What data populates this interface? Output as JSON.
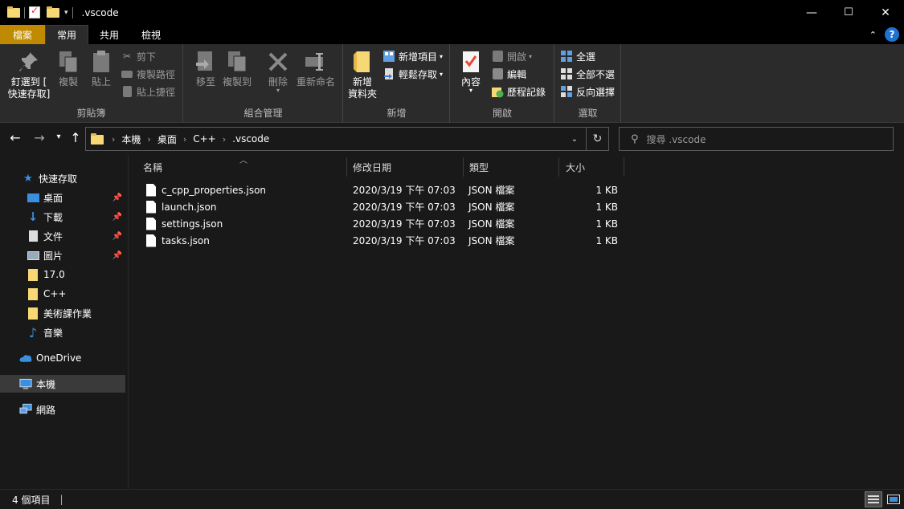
{
  "window": {
    "title": ".vscode",
    "minimize": "—",
    "maximize": "☐",
    "close": "✕"
  },
  "ribbon_tabs": [
    "檔案",
    "常用",
    "共用",
    "檢視"
  ],
  "ribbon": {
    "clipboard": {
      "label": "剪貼簿",
      "pin_label_1": "釘選到 [",
      "pin_label_2": "快速存取]",
      "copy": "複製",
      "paste": "貼上",
      "cut": "剪下",
      "copy_path": "複製路徑",
      "paste_shortcut": "貼上捷徑"
    },
    "organize": {
      "label": "組合管理",
      "move_to": "移至",
      "copy_to": "複製到",
      "delete": "刪除",
      "rename": "重新命名"
    },
    "new": {
      "label": "新增",
      "new_folder_1": "新增",
      "new_folder_2": "資料夾",
      "new_item": "新增項目",
      "easy_access": "輕鬆存取"
    },
    "open": {
      "label": "開啟",
      "properties": "內容",
      "open": "開啟",
      "edit": "編輯",
      "history": "歷程記錄"
    },
    "select": {
      "label": "選取",
      "select_all": "全選",
      "select_none": "全部不選",
      "invert": "反向選擇"
    }
  },
  "address": {
    "crumbs": [
      "本機",
      "桌面",
      "C++",
      ".vscode"
    ],
    "search_placeholder": "搜尋 .vscode"
  },
  "sidebar": {
    "quick_access": "快速存取",
    "items": [
      {
        "label": "桌面",
        "pinned": true
      },
      {
        "label": "下載",
        "pinned": true
      },
      {
        "label": "文件",
        "pinned": true
      },
      {
        "label": "圖片",
        "pinned": true
      },
      {
        "label": "17.0"
      },
      {
        "label": "C++"
      },
      {
        "label": "美術課作業"
      },
      {
        "label": "音樂"
      }
    ],
    "onedrive": "OneDrive",
    "this_pc": "本機",
    "network": "網路"
  },
  "columns": [
    "名稱",
    "修改日期",
    "類型",
    "大小"
  ],
  "files": [
    {
      "name": "c_cpp_properties.json",
      "modified": "2020/3/19 下午 07:03",
      "type": "JSON 檔案",
      "size": "1 KB"
    },
    {
      "name": "launch.json",
      "modified": "2020/3/19 下午 07:03",
      "type": "JSON 檔案",
      "size": "1 KB"
    },
    {
      "name": "settings.json",
      "modified": "2020/3/19 下午 07:03",
      "type": "JSON 檔案",
      "size": "1 KB"
    },
    {
      "name": "tasks.json",
      "modified": "2020/3/19 下午 07:03",
      "type": "JSON 檔案",
      "size": "1 KB"
    }
  ],
  "status": {
    "count": "4 個項目",
    "separator": "|"
  },
  "colors": {
    "file_tab": "#c08a00",
    "accent_blue": "#1e73d2",
    "folder": "#f8d775"
  },
  "icons": [
    "folder-icon",
    "properties-icon",
    "pin-icon",
    "copy-icon",
    "paste-icon",
    "cut-icon",
    "move-icon",
    "delete-icon",
    "rename-icon",
    "new-folder-icon",
    "history-icon",
    "select-all-icon",
    "search-icon",
    "refresh-icon",
    "star-icon",
    "download-icon",
    "music-icon",
    "cloud-icon",
    "computer-icon",
    "network-icon",
    "file-icon"
  ]
}
